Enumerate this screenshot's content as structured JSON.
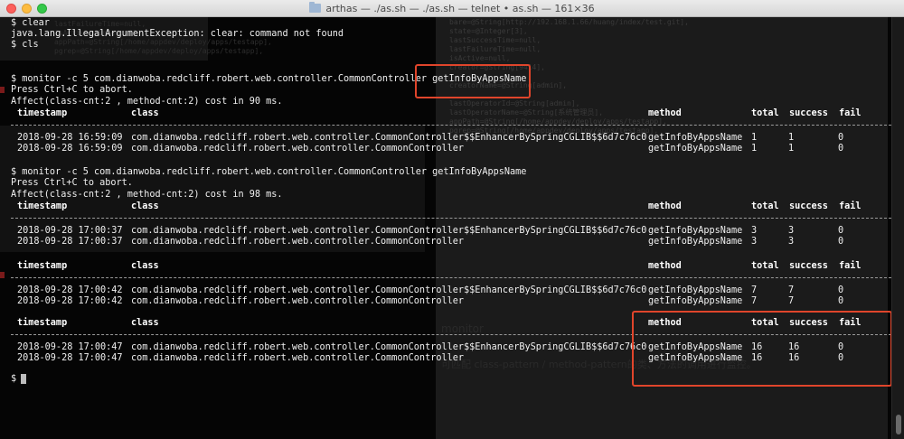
{
  "window": {
    "title": "arthas — ./as.sh — ./as.sh — telnet • as.sh — 161×36"
  },
  "terminal_lines": {
    "l1": "$ clear",
    "l2": "java.lang.IllegalArgumentException: clear: command not found",
    "l3": "$ cls",
    "l4": "$ monitor -c 5 com.dianwoba.redcliff.robert.web.controller.CommonController ",
    "l4_method": "getInfoByAppsName",
    "l5": "Press Ctrl+C to abort.",
    "l6": "Affect(class-cnt:2 , method-cnt:2) cost in 90 ms.",
    "l7": "$ monitor -c 5 com.dianwoba.redcliff.robert.web.controller.CommonController getInfoByAppsName",
    "l8": "Press Ctrl+C to abort.",
    "l9": "Affect(class-cnt:2 , method-cnt:2) cost in 98 ms.",
    "prompt": "$"
  },
  "table_headers": {
    "timestamp": "timestamp",
    "class": "class",
    "method": "method",
    "total": "total",
    "success": "success",
    "fail": "fail"
  },
  "blocks": [
    {
      "rows": [
        {
          "timestamp": "2018-09-28 16:59:09",
          "class": "com.dianwoba.redcliff.robert.web.controller.CommonController$$EnhancerBySpringCGLIB$$6d7c76c0",
          "method": "getInfoByAppsName",
          "total": "1",
          "success": "1",
          "fail": "0"
        },
        {
          "timestamp": "2018-09-28 16:59:09",
          "class": "com.dianwoba.redcliff.robert.web.controller.CommonController",
          "method": "getInfoByAppsName",
          "total": "1",
          "success": "1",
          "fail": "0"
        }
      ]
    },
    {
      "rows": [
        {
          "timestamp": "2018-09-28 17:00:37",
          "class": "com.dianwoba.redcliff.robert.web.controller.CommonController$$EnhancerBySpringCGLIB$$6d7c76c0",
          "method": "getInfoByAppsName",
          "total": "3",
          "success": "3",
          "fail": "0"
        },
        {
          "timestamp": "2018-09-28 17:00:37",
          "class": "com.dianwoba.redcliff.robert.web.controller.CommonController",
          "method": "getInfoByAppsName",
          "total": "3",
          "success": "3",
          "fail": "0"
        }
      ]
    },
    {
      "rows": [
        {
          "timestamp": "2018-09-28 17:00:42",
          "class": "com.dianwoba.redcliff.robert.web.controller.CommonController$$EnhancerBySpringCGLIB$$6d7c76c0",
          "method": "getInfoByAppsName",
          "total": "7",
          "success": "7",
          "fail": "0"
        },
        {
          "timestamp": "2018-09-28 17:00:42",
          "class": "com.dianwoba.redcliff.robert.web.controller.CommonController",
          "method": "getInfoByAppsName",
          "total": "7",
          "success": "7",
          "fail": "0"
        }
      ]
    },
    {
      "rows": [
        {
          "timestamp": "2018-09-28 17:00:47",
          "class": "com.dianwoba.redcliff.robert.web.controller.CommonController$$EnhancerBySpringCGLIB$$6d7c76c0",
          "method": "getInfoByAppsName",
          "total": "16",
          "success": "16",
          "fail": "0"
        },
        {
          "timestamp": "2018-09-28 17:00:47",
          "class": "com.dianwoba.redcliff.robert.web.controller.CommonController",
          "method": "getInfoByAppsName",
          "total": "16",
          "success": "16",
          "fail": "0"
        }
      ]
    }
  ],
  "background_overlay": {
    "right_lines": [
      "bare=@String[http://192.168.1.66/huang/index/test.git],",
      "state=@Integer[3],",
      "lastSuccessTime=null,",
      "lastFailureTime=null,",
      "isActive=null,",
      "creator=@String[9414],",
      "",
      "creatorName=@String[admin],",
      "",
      "lastOperatorId=@String[admin],",
      "lastOperatorName=@String[系统管理员],",
      "appPath=@String[/home/appdev/deploy/apps/testapp],",
      "pgrep=@String[/home/appdev/deploy/apps/testapp],"
    ],
    "left_top_lines": [
      "lastFailureTime=null,",
      "isActive=@Integer[1],",
      "appPath=@String[/home/appdev/deploy/apps/testapp],",
      "pgrep=@String[/home/appdev/deploy/apps/testapp],"
    ],
    "monitor_text": "monitor",
    "cjk_text": "可匹配 class-pattern / method-pattern的类、方法的调用进行监控。"
  },
  "colors": {
    "terminal_bg": "#050505",
    "text": "#f0f0f0",
    "highlight": "#e0452b"
  }
}
